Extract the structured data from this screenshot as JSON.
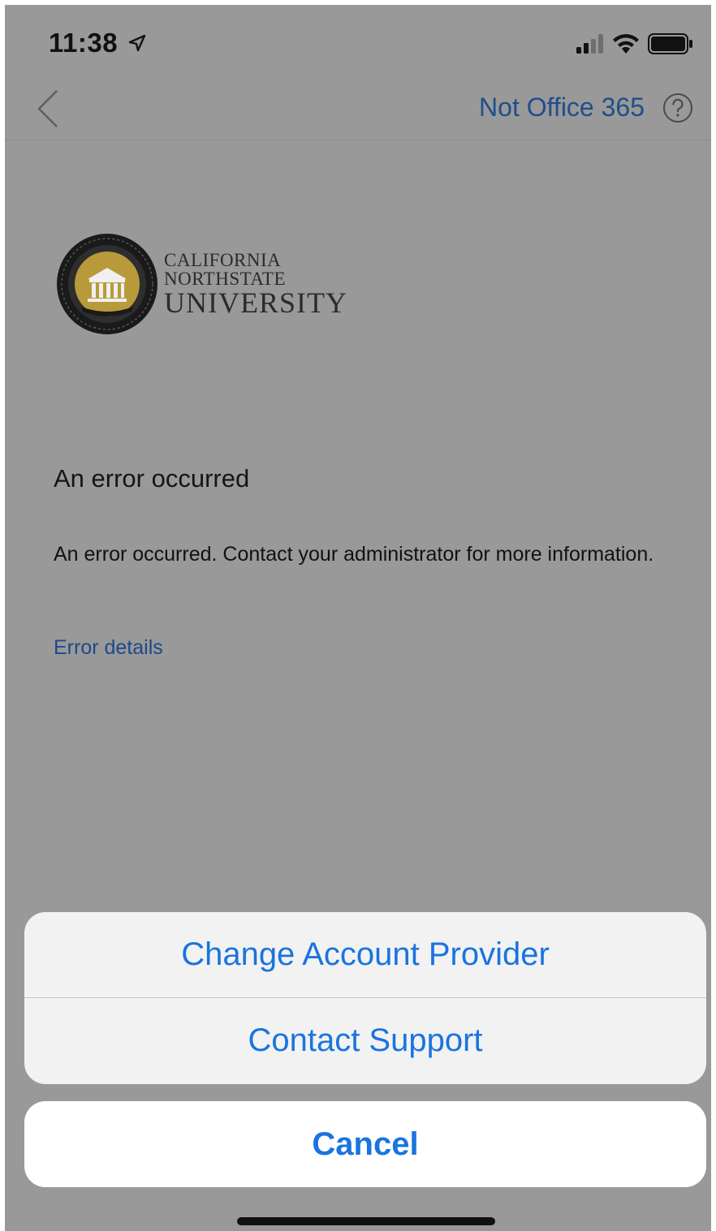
{
  "status_bar": {
    "time": "11:38",
    "icons": [
      "location-arrow-icon",
      "cellular-signal-icon",
      "wifi-icon",
      "battery-icon"
    ]
  },
  "nav": {
    "title": "Not Office 365",
    "icons": [
      "back-chevron-icon",
      "help-icon"
    ]
  },
  "logo": {
    "line1": "CALIFORNIA",
    "line2": "NORTHSTATE",
    "line3": "UNIVERSITY"
  },
  "content": {
    "error_title": "An error occurred",
    "error_message": "An error occurred. Contact your administrator for more information.",
    "error_details_link": "Error details"
  },
  "action_sheet": {
    "change_provider": "Change Account Provider",
    "contact_support": "Contact Support",
    "cancel": "Cancel"
  },
  "colors": {
    "overlay": "#999999",
    "accent": "#1a74e0",
    "link": "#1d4a8a",
    "seal_gold": "#b89a3a"
  }
}
